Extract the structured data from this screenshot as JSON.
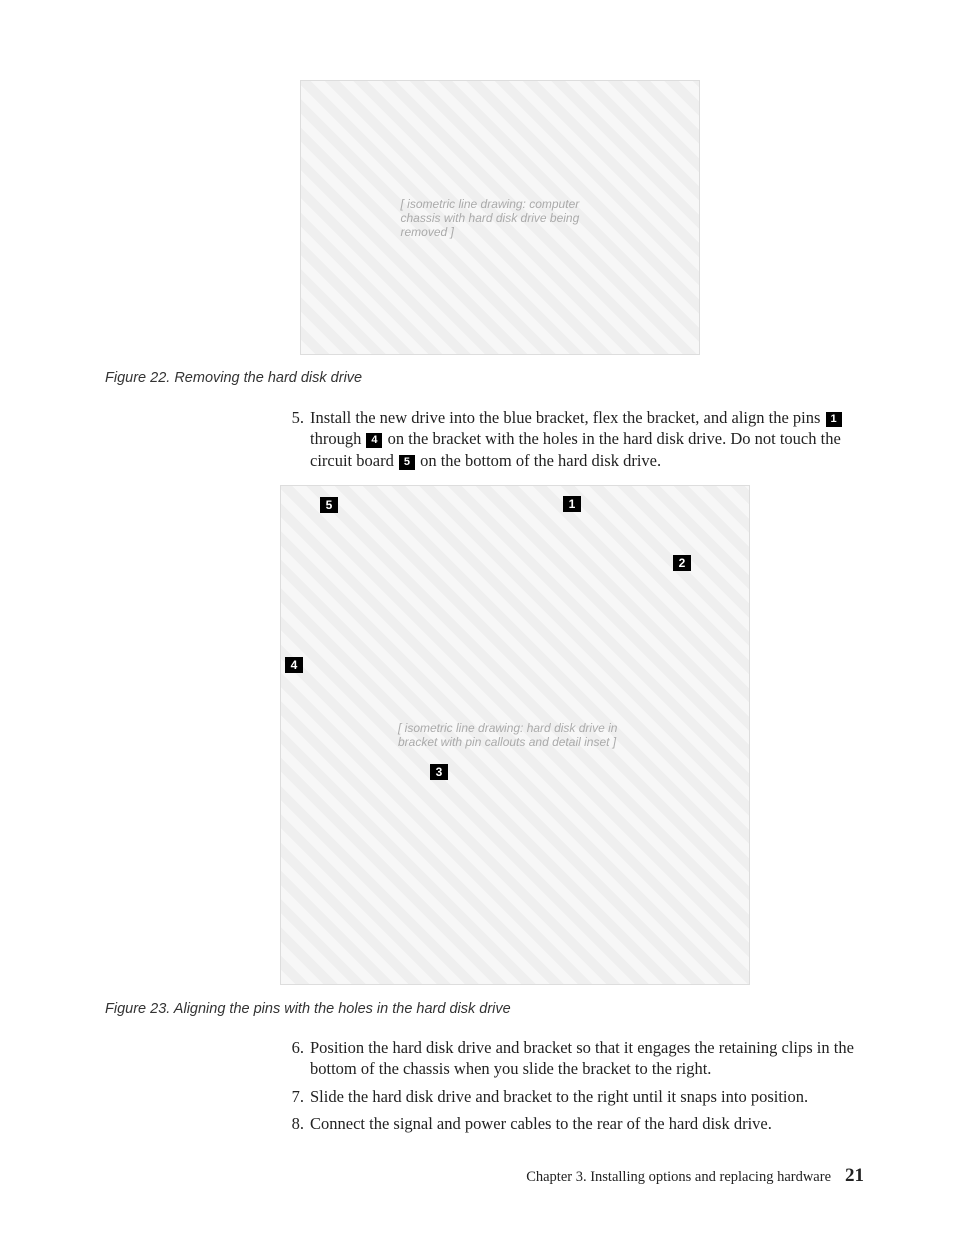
{
  "figures": {
    "fig22": {
      "caption_prefix": "Figure 22.",
      "caption_text": "Removing the hard disk drive",
      "img_label": "[ isometric line drawing: computer chassis with hard disk drive being removed ]"
    },
    "fig23": {
      "caption_prefix": "Figure 23.",
      "caption_text": "Aligning the pins with the holes in the hard disk drive",
      "img_label": "[ isometric line drawing: hard disk drive in bracket with pin callouts and detail inset ]",
      "callouts": {
        "c1": "1",
        "c2": "2",
        "c3": "3",
        "c4": "4",
        "c5": "5"
      }
    }
  },
  "steps": {
    "s5": {
      "num": "5.",
      "pre": "Install the new drive into the blue bracket, flex the bracket, and align the pins ",
      "co1": "1",
      "mid1": " through ",
      "co4": "4",
      "mid2": " on the bracket with the holes in the hard disk drive. Do not touch the circuit board ",
      "co5": "5",
      "post": " on the bottom of the hard disk drive."
    },
    "s6": {
      "num": "6.",
      "text": "Position the hard disk drive and bracket so that it engages the retaining clips in the bottom of the chassis when you slide the bracket to the right."
    },
    "s7": {
      "num": "7.",
      "text": "Slide the hard disk drive and bracket to the right until it snaps into position."
    },
    "s8": {
      "num": "8.",
      "text": "Connect the signal and power cables to the rear of the hard disk drive."
    }
  },
  "footer": {
    "chapter": "Chapter 3. Installing options and replacing hardware",
    "page": "21"
  }
}
